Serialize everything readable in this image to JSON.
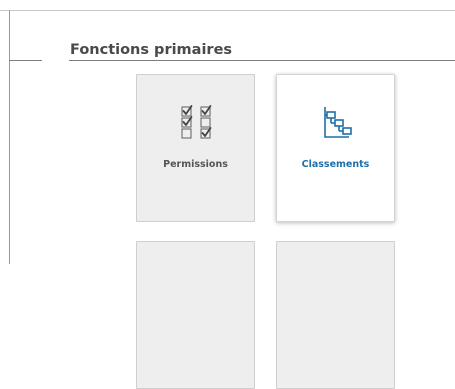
{
  "section": {
    "title": "Fonctions primaires"
  },
  "tiles": [
    {
      "label": "Permissions",
      "icon": "checklist-icon",
      "state": "disabled"
    },
    {
      "label": "Classements",
      "icon": "hierarchy-icon",
      "state": "active"
    },
    {
      "label": "",
      "icon": "",
      "state": "disabled"
    },
    {
      "label": "",
      "icon": "",
      "state": "disabled"
    }
  ],
  "colors": {
    "accent": "#1f6fa8",
    "tile_disabled_bg": "#eeeeee",
    "title": "#4a4a4a"
  }
}
